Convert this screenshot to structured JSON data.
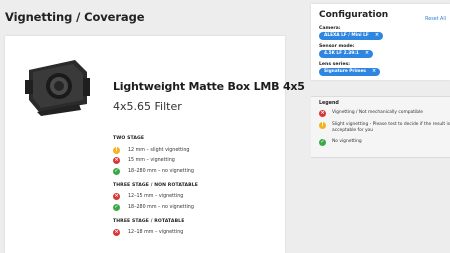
{
  "page": {
    "title": "Vignetting / Coverage"
  },
  "product": {
    "name": "Lightweight Matte Box LMB 4x5",
    "subtitle": "4x5.65 Filter"
  },
  "results": [
    {
      "heading": "TWO STAGE",
      "items": [
        {
          "status": "yellow",
          "text": "12 mm – slight vignetting"
        },
        {
          "status": "red",
          "text": "15 mm – vignetting"
        },
        {
          "status": "green",
          "text": "18–280 mm – no vignetting"
        }
      ]
    },
    {
      "heading": "THREE STAGE / NON ROTATABLE",
      "items": [
        {
          "status": "red",
          "text": "12–15 mm – vignetting"
        },
        {
          "status": "green",
          "text": "18–280 mm – no vignetting"
        }
      ]
    },
    {
      "heading": "THREE STAGE / ROTATABLE",
      "items": [
        {
          "status": "red",
          "text": "12–18 mm – vignetting"
        }
      ]
    }
  ],
  "config": {
    "title": "Configuration",
    "reset_label": "Reset All",
    "camera_label": "Camera:",
    "camera_value": "ALEXA LF / Mini LF",
    "sensor_label": "Sensor mode:",
    "sensor_value": "4.5K LF 2.39:1",
    "lens_label": "Lens series:",
    "lens_value": "Signature Primes",
    "chip_remove_icon": "×"
  },
  "legend": {
    "title": "Legend",
    "items": [
      {
        "status": "red",
        "text": "Vignetting / Not mechanically compatible"
      },
      {
        "status": "yellow",
        "text": "Slight vignetting - Please test to decide if the result is acceptable for you"
      },
      {
        "status": "green",
        "text": "No vignetting"
      }
    ]
  },
  "icons": {
    "red": "close-circle-icon",
    "yellow": "exclamation-circle-icon",
    "green": "check-circle-icon"
  },
  "colors": {
    "red": "#d93535",
    "yellow": "#f0b321",
    "green": "#3aa845",
    "accent": "#2f86e0"
  }
}
